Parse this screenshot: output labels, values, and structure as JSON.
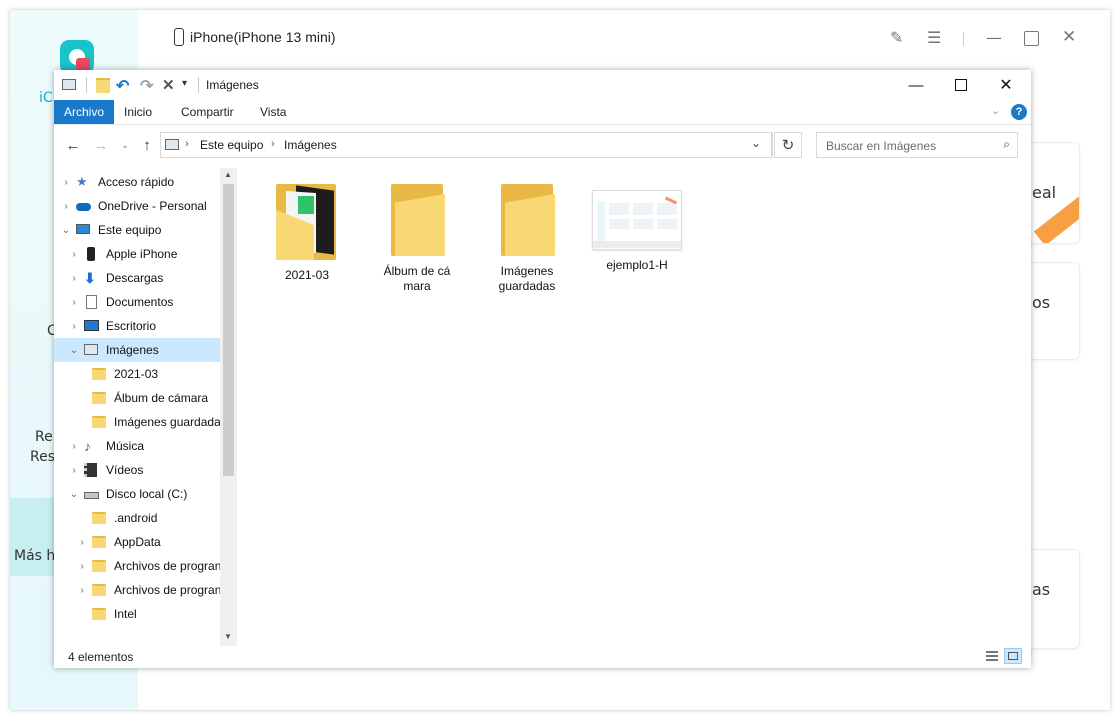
{
  "app": {
    "device_title": "iPhone(iPhone 13 mini)",
    "sidebar_fragments": [
      "iC",
      "C",
      "Re",
      "Res",
      "Más h"
    ],
    "card_fragments": [
      "eal",
      "os",
      "as"
    ]
  },
  "explorer": {
    "title": "Imágenes",
    "ribbon_tabs": [
      "Archivo",
      "Inicio",
      "Compartir",
      "Vista"
    ],
    "breadcrumb": [
      "Este equipo",
      "Imágenes"
    ],
    "search_placeholder": "Buscar en Imágenes",
    "nav_tree": [
      {
        "label": "Acceso rápido",
        "icon": "star-icon"
      },
      {
        "label": "OneDrive - Personal",
        "icon": "cloud-icon"
      },
      {
        "label": "Este equipo",
        "icon": "computer-icon"
      },
      {
        "label": "Apple iPhone",
        "icon": "phone-icon"
      },
      {
        "label": "Descargas",
        "icon": "download-icon"
      },
      {
        "label": "Documentos",
        "icon": "document-icon"
      },
      {
        "label": "Escritorio",
        "icon": "desktop-icon"
      },
      {
        "label": "Imágenes",
        "icon": "pictures-icon"
      },
      {
        "label": "2021-03",
        "icon": "folder-icon"
      },
      {
        "label": "Álbum de cámara",
        "icon": "folder-icon"
      },
      {
        "label": "Imágenes guardada",
        "icon": "folder-icon"
      },
      {
        "label": "Música",
        "icon": "music-icon"
      },
      {
        "label": "Vídeos",
        "icon": "video-icon"
      },
      {
        "label": "Disco local (C:)",
        "icon": "drive-icon"
      },
      {
        "label": ".android",
        "icon": "folder-icon"
      },
      {
        "label": "AppData",
        "icon": "folder-icon"
      },
      {
        "label": "Archivos de progran",
        "icon": "folder-icon"
      },
      {
        "label": "Archivos de progran",
        "icon": "folder-icon"
      },
      {
        "label": "Intel",
        "icon": "folder-icon"
      }
    ],
    "files": [
      {
        "name": "2021-03",
        "kind": "folder"
      },
      {
        "name": "Álbum de cá mara",
        "kind": "folder"
      },
      {
        "name": "Imágenes guardadas",
        "kind": "folder"
      },
      {
        "name": "ejemplo1-H",
        "kind": "image"
      }
    ],
    "status": "4 elementos"
  },
  "colors": {
    "ribbon_active": "#1979ca",
    "selection": "#cce8ff",
    "folder": "#f8d775",
    "app_accent": "#18c3c9"
  }
}
